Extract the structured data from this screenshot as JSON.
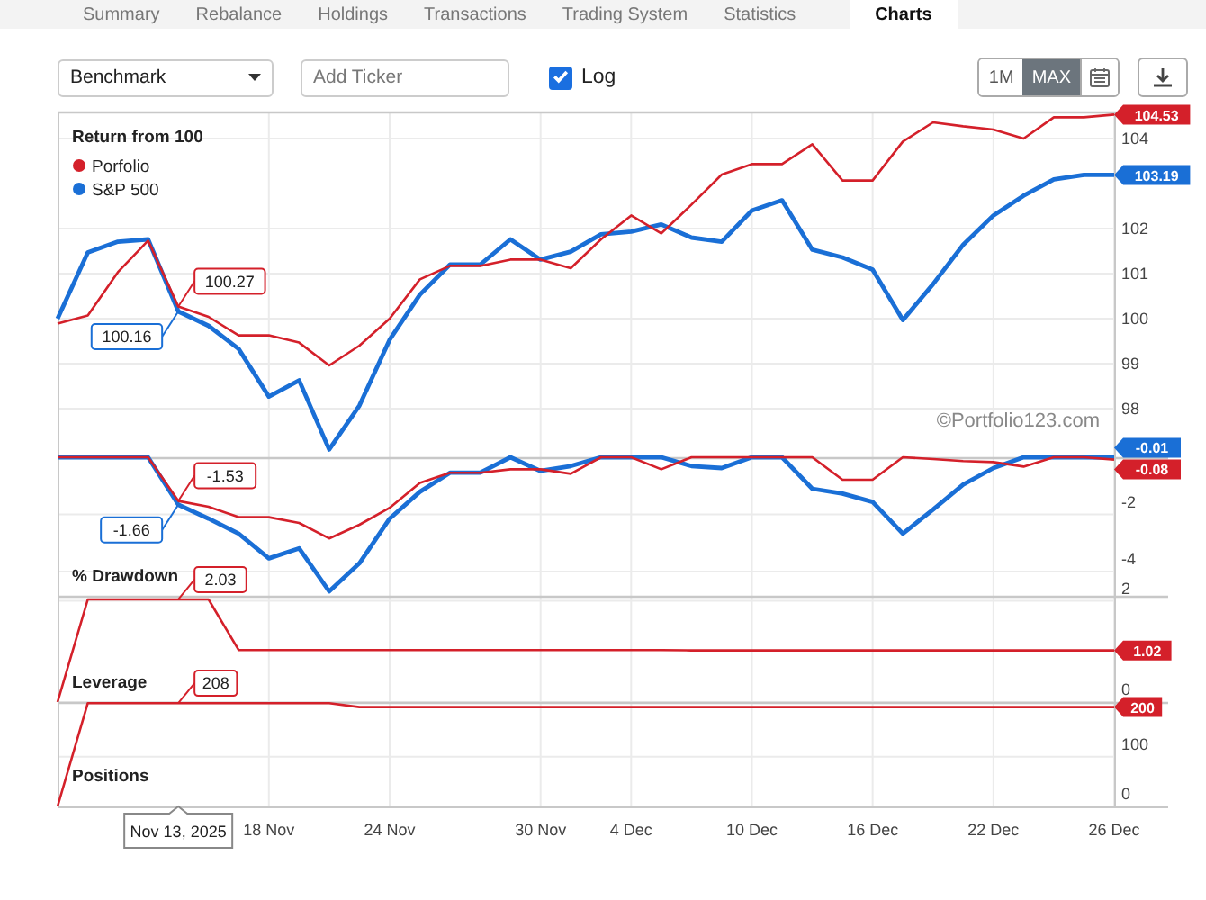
{
  "tabs": [
    {
      "label": "Summary",
      "selected": false
    },
    {
      "label": "Rebalance",
      "selected": false
    },
    {
      "label": "Holdings",
      "selected": false
    },
    {
      "label": "Transactions",
      "selected": false
    },
    {
      "label": "Trading System",
      "selected": false
    },
    {
      "label": "Statistics",
      "selected": false
    },
    {
      "label": "Charts",
      "selected": true
    }
  ],
  "toolbar": {
    "benchmark_select": {
      "value": "Benchmark"
    },
    "ticker_field": {
      "placeholder": "Add Ticker"
    },
    "log_checkbox": {
      "label": "Log",
      "checked": true
    },
    "range_buttons": [
      {
        "label": "1M",
        "selected": false
      },
      {
        "label": "MAX",
        "selected": true
      }
    ]
  },
  "credit": "©Portfolio123.com",
  "panels": [
    {
      "chart_data": {
        "type": "line",
        "title": "Return from 100",
        "grid": true,
        "legend": true,
        "ylim": [
          96.92,
          104.6
        ],
        "yticks": [
          98,
          99,
          100,
          101,
          102,
          104
        ],
        "series": [
          {
            "name": "Porfolio",
            "color": "#d4202a",
            "values": [
              99.89,
              100.07,
              101.03,
              101.73,
              100.27,
              100.04,
              99.63,
              99.63,
              99.47,
              98.96,
              99.4,
              100.0,
              100.87,
              101.17,
              101.17,
              101.31,
              101.31,
              101.12,
              101.76,
              102.29,
              101.89,
              102.53,
              103.2,
              103.43,
              103.43,
              103.87,
              103.07,
              103.07,
              103.93,
              104.36,
              104.27,
              104.2,
              104.0,
              104.47,
              104.47,
              104.53
            ]
          },
          {
            "name": "S&P 500",
            "color": "#1a6fd6",
            "values": [
              100.0,
              101.47,
              101.71,
              101.76,
              100.16,
              99.84,
              99.33,
              98.27,
              98.63,
              97.09,
              98.07,
              99.53,
              100.53,
              101.2,
              101.2,
              101.76,
              101.31,
              101.49,
              101.87,
              101.93,
              102.09,
              101.8,
              101.71,
              102.4,
              102.63,
              101.53,
              101.36,
              101.09,
              99.97,
              100.77,
              101.64,
              102.29,
              102.73,
              103.09,
              103.19,
              103.19
            ]
          }
        ],
        "annotations": [
          "100.27",
          "100.16",
          "104.53",
          "103.19"
        ]
      }
    },
    {
      "chart_data": {
        "type": "line",
        "title": "% Drawdown",
        "grid": true,
        "ylim": [
          -4.85,
          0
        ],
        "yticks": [
          -2,
          -4
        ],
        "series": [
          {
            "color": "#d4202a",
            "values": [
              0,
              0,
              0,
              0,
              -1.53,
              -1.73,
              -2.1,
              -2.1,
              -2.3,
              -2.84,
              -2.36,
              -1.77,
              -0.9,
              -0.54,
              -0.54,
              -0.42,
              -0.42,
              -0.58,
              0,
              0,
              -0.42,
              0,
              0,
              0,
              0,
              0,
              -0.79,
              -0.79,
              0,
              -0.06,
              -0.13,
              -0.17,
              -0.33,
              0,
              0,
              -0.08
            ]
          },
          {
            "color": "#1a6fd6",
            "values": [
              0,
              0,
              0,
              0,
              -1.66,
              -2.15,
              -2.67,
              -3.54,
              -3.19,
              -4.69,
              -3.71,
              -2.15,
              -1.21,
              -0.54,
              -0.54,
              0,
              -0.48,
              -0.31,
              0,
              0,
              0,
              -0.31,
              -0.38,
              0,
              0,
              -1.1,
              -1.27,
              -1.56,
              -2.67,
              -1.83,
              -0.96,
              -0.38,
              0,
              0,
              0,
              -0.01
            ]
          }
        ],
        "annotations": [
          "-1.53",
          "-1.66",
          "-0.08",
          "-0.01"
        ]
      }
    },
    {
      "chart_data": {
        "type": "line",
        "title": "Leverage",
        "grid": true,
        "ylim": [
          0,
          2.1
        ],
        "yticks": [
          0,
          2
        ],
        "series": [
          {
            "color": "#d4202a",
            "values": [
              0,
              2.03,
              2.03,
              2.03,
              2.03,
              2.03,
              1.03,
              1.03,
              1.03,
              1.03,
              1.03,
              1.03,
              1.03,
              1.03,
              1.03,
              1.03,
              1.03,
              1.03,
              1.03,
              1.03,
              1.03,
              1.02,
              1.02,
              1.02,
              1.02,
              1.02,
              1.02,
              1.02,
              1.02,
              1.02,
              1.02,
              1.02,
              1.02,
              1.02,
              1.02,
              1.02
            ]
          }
        ],
        "annotations": [
          "2.03",
          "1.02"
        ]
      }
    },
    {
      "chart_data": {
        "type": "line",
        "title": "Positions",
        "grid": true,
        "ylim": [
          0,
          210
        ],
        "yticks": [
          0,
          100
        ],
        "categories": [
          null,
          null,
          null,
          null,
          "Nov 13, 2025",
          null,
          null,
          "18 Nov",
          null,
          null,
          null,
          "24 Nov",
          null,
          null,
          null,
          null,
          "30 Nov",
          null,
          null,
          "4 Dec",
          null,
          null,
          null,
          "10 Dec",
          null,
          null,
          null,
          "16 Dec",
          null,
          null,
          null,
          "22 Dec",
          null,
          null,
          null,
          "26 Dec"
        ],
        "series": [
          {
            "color": "#d4202a",
            "values": [
              0,
              208,
              208,
              208,
              208,
              208,
              208,
              208,
              208,
              208,
              200,
              200,
              200,
              200,
              200,
              200,
              200,
              200,
              200,
              200,
              200,
              200,
              200,
              200,
              200,
              200,
              200,
              200,
              200,
              200,
              200,
              200,
              200,
              200,
              200,
              200
            ]
          }
        ],
        "annotations": [
          "208",
          "200"
        ]
      }
    }
  ]
}
